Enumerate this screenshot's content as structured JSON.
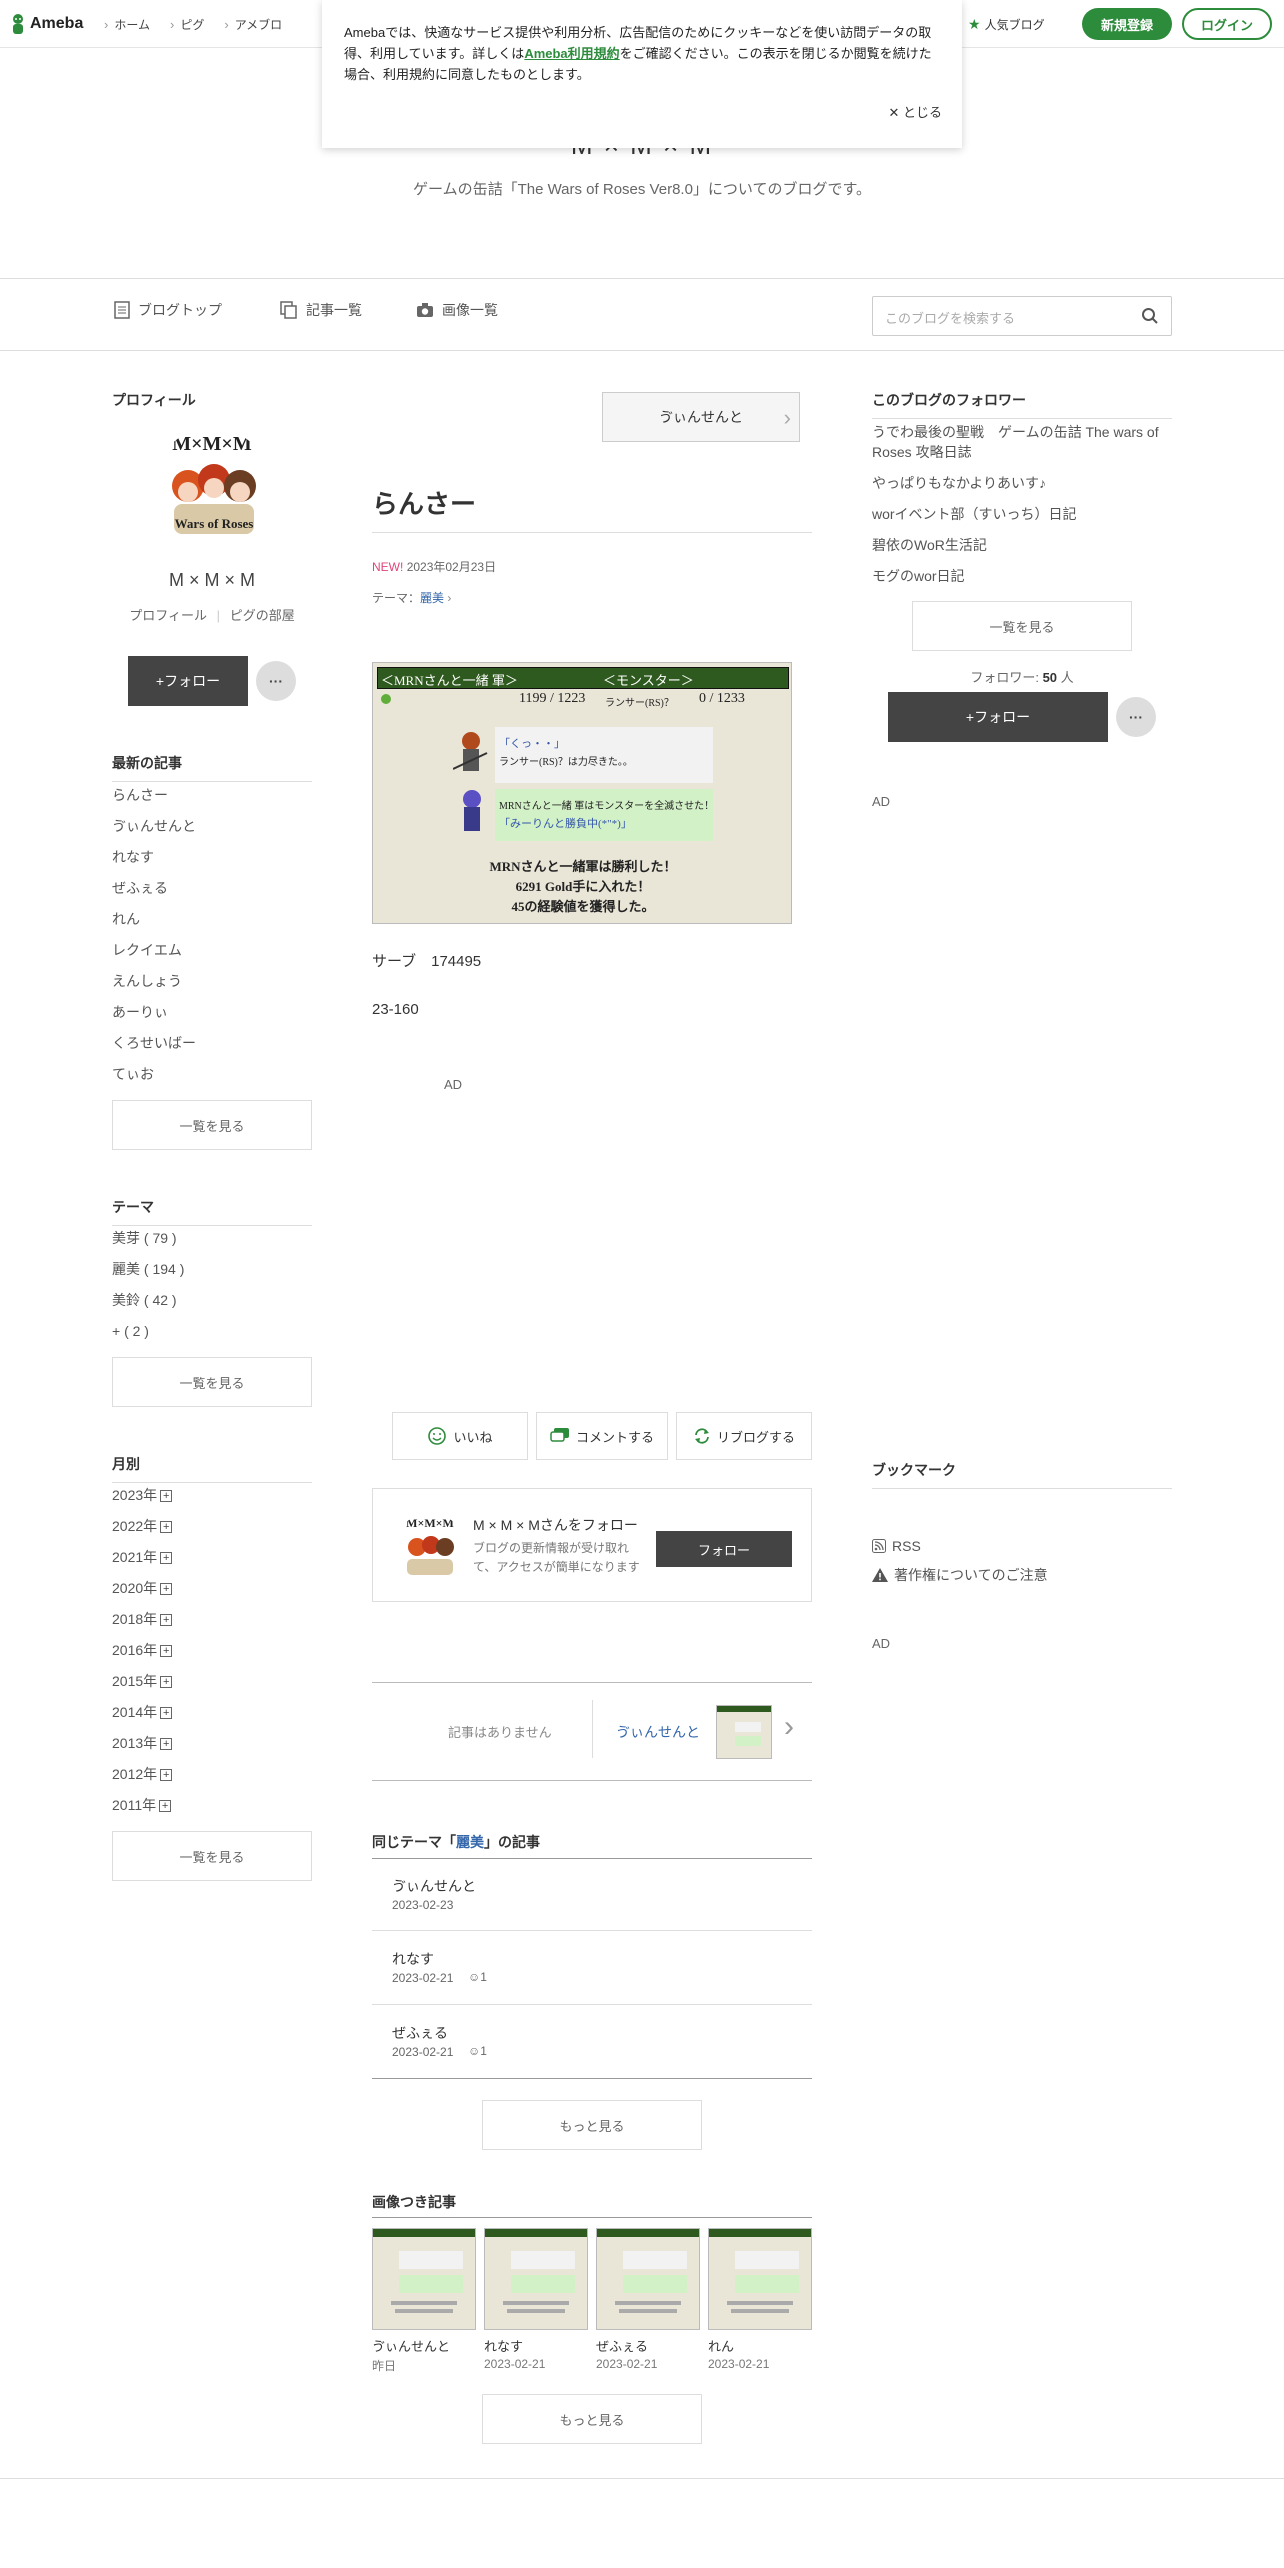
{
  "header": {
    "logo": "Ameba",
    "crumbs": [
      "ホーム",
      "ピグ",
      "アメブロ"
    ],
    "popular": "人気ブログ",
    "register": "新規登録",
    "login": "ログイン"
  },
  "cookie": {
    "text_a": "Amebaでは、快適なサービス提供や利用分析、広告配信のためにクッキーなどを使い訪問データの取得、利用しています。詳しくは",
    "link": "Ameba利用規約",
    "text_b": "をご確認ください。この表示を閉じるか閲覧を続けた場合、利用規約に同意したものとします。",
    "close": "とじる"
  },
  "blog": {
    "title": "M × M × M",
    "description": "ゲームの缶詰「The Wars of Roses Ver8.0」についてのブログです。"
  },
  "nav": {
    "top": "ブログトップ",
    "articles": "記事一覧",
    "images": "画像一覧",
    "search_placeholder": "このブログを検索する"
  },
  "profile": {
    "heading": "プロフィール",
    "name": "M × M × M",
    "link_profile": "プロフィール",
    "link_room": "ピグの部屋",
    "follow": "+フォロー",
    "more": "···"
  },
  "recent": {
    "heading": "最新の記事",
    "items": [
      "らんさー",
      "ゔぃんせんと",
      "れなす",
      "ぜふぇる",
      "れん",
      "レクイエム",
      "えんしょう",
      "あーりぃ",
      "くろせいばー",
      "てぃお"
    ],
    "more": "一覧を見る"
  },
  "themes": {
    "heading": "テーマ",
    "items": [
      "美芽 ( 79 )",
      "麗美 ( 194 )",
      "美鈴 ( 42 )",
      "+ ( 2 )"
    ],
    "more": "一覧を見る"
  },
  "monthly": {
    "heading": "月別",
    "items": [
      "2023年",
      "2022年",
      "2021年",
      "2020年",
      "2018年",
      "2016年",
      "2015年",
      "2014年",
      "2013年",
      "2012年",
      "2011年"
    ],
    "more": "一覧を見る"
  },
  "article": {
    "next_title": "ゔぃんせんと",
    "title": "らんさー",
    "new_badge": "NEW!",
    "date": "2023年02月23日",
    "theme_label": "テーマ：",
    "theme": "麗美",
    "battle": {
      "left_head": "＜MRNさんと一緒 軍＞",
      "right_head": "＜モンスター＞",
      "left_hp": "1199 / 1223",
      "right_label": "ランサー(RS)？",
      "right_hp": "0 / 1233",
      "line1": "「くっ・・」",
      "line2": "ランサー(RS)？は力尽きた。。",
      "line3": "MRNさんと一緒 軍はモンスターを全滅させた！",
      "line4": "「みーりんと勝負中(*\"*)」",
      "res1": "MRNさんと一緒軍は勝利した！",
      "res2": "6291 Gold手に入れた！",
      "res3": "45の経験値を獲得した。"
    },
    "body1": "サーブ　174495",
    "body2": "23-160",
    "ad": "AD"
  },
  "actions": {
    "like": "いいね",
    "comment": "コメントする",
    "reblog": "リブログする"
  },
  "followcard": {
    "title": "M × M × Mさんをフォロー",
    "desc": "ブログの更新情報が受け取れて、アクセスが簡単になります",
    "button": "フォロー"
  },
  "pager": {
    "prev": "記事はありません",
    "next": "ゔぃんせんと"
  },
  "same_theme": {
    "heading_a": "同じテーマ「",
    "theme": "麗美",
    "heading_b": "」の記事",
    "items": [
      {
        "title": "ゔぃんせんと",
        "date": "2023-02-23",
        "likes": ""
      },
      {
        "title": "れなす",
        "date": "2023-02-21",
        "likes": "1"
      },
      {
        "title": "ぜふぇる",
        "date": "2023-02-21",
        "likes": "1"
      }
    ],
    "more": "もっと見る"
  },
  "image_articles": {
    "heading": "画像つき記事",
    "items": [
      {
        "title": "ゔぃんせんと",
        "date": "昨日"
      },
      {
        "title": "れなす",
        "date": "2023-02-21"
      },
      {
        "title": "ぜふぇる",
        "date": "2023-02-21"
      },
      {
        "title": "れん",
        "date": "2023-02-21"
      }
    ],
    "more": "もっと見る"
  },
  "followers": {
    "heading": "このブログのフォロワー",
    "items": [
      "うでわ最後の聖戦　ゲームの缶詰 The wars of Roses 攻略日誌",
      "やっぱりもなかよりあいす♪",
      "worイベント部（すいっち）日記",
      "碧依のWoR生活記",
      "モグのwor日記"
    ],
    "more": "一覧を見る",
    "count_label": "フォロワー:",
    "count": "50",
    "count_unit": "人",
    "follow": "+フォロー",
    "ad": "AD"
  },
  "bookmark": {
    "heading": "ブックマーク",
    "rss": "RSS",
    "copyright": "著作権についてのご注意",
    "ad": "AD"
  },
  "colors": {
    "brand_green": "#2d8c3c",
    "link_blue": "#3366aa",
    "new_pink": "#e0457b"
  }
}
